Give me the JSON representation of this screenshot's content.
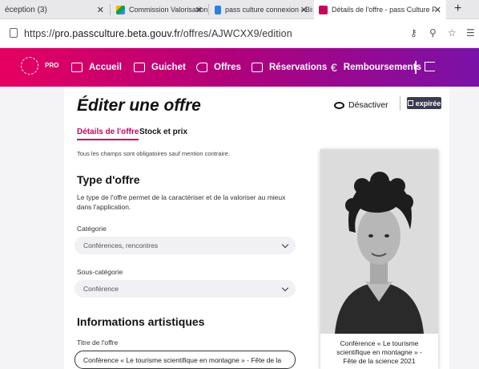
{
  "browser": {
    "tabs": [
      {
        "title": "éception (3)",
        "active": false
      },
      {
        "title": "Commission Valorisation du Patr",
        "active": false
      },
      {
        "title": "pass culture connexion - Bing",
        "active": false
      },
      {
        "title": "Détails de l'offre - pass Culture F",
        "active": true
      }
    ],
    "url_prefix": "https://",
    "url_host": "pro.passculture.beta.gouv.fr",
    "url_path": "/offres/AJWCXX9/edition"
  },
  "header": {
    "logo_text": "PRO",
    "nav": [
      {
        "label": "Accueil",
        "icon": "home-icon"
      },
      {
        "label": "Guichet",
        "icon": "ticket-icon"
      },
      {
        "label": "Offres",
        "icon": "offer-icon"
      },
      {
        "label": "Réservations",
        "icon": "calendar-icon"
      },
      {
        "label": "Remboursements",
        "icon": "euro-icon"
      }
    ],
    "colors": {
      "gradient_start": "#e5005f",
      "gradient_end": "#7a12a8"
    }
  },
  "page": {
    "title": "Éditer une offre",
    "deactivate_label": "Désactiver",
    "status_badge": "expirée",
    "tabs": [
      "Détails de l'offre",
      "Stock et prix"
    ],
    "required_hint": "Tous les champs sont obligatoires sauf mention contraire.",
    "type_section": {
      "heading": "Type d'offre",
      "description": "Le type de l'offre permet de la caractériser et de la valoriser au mieux dans l'application.",
      "category_label": "Catégorie",
      "category_value": "Conférences, rencontres",
      "subcategory_label": "Sous-catégorie",
      "subcategory_value": "Conférence"
    },
    "artistic_section": {
      "heading": "Informations artistiques",
      "title_label": "Titre de l'offre",
      "title_value": "Conférence « Le tourisme scientifique en montagne » - Fête de la"
    },
    "preview": {
      "caption_line1": "Conférence « Le tourisme",
      "caption_line2": "scientifique en montagne » -",
      "caption_line3": "Fête de la science 2021"
    },
    "accent_color": "#c8045f"
  }
}
